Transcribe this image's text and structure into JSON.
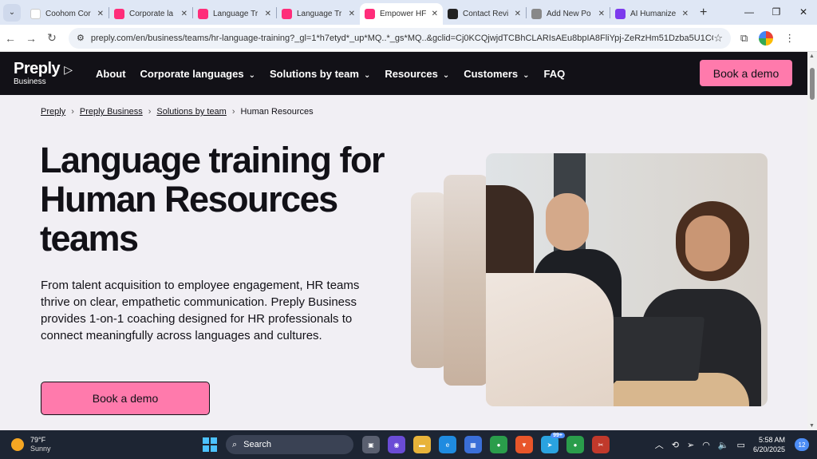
{
  "browser": {
    "tabs": [
      {
        "label": "Coohom Cor",
        "icon": "google-icon",
        "color": "#ffffff"
      },
      {
        "label": "Corporate la",
        "icon": "preply-icon",
        "color": "#ff2d7a"
      },
      {
        "label": "Language Tr",
        "icon": "preply-icon",
        "color": "#ff2d7a"
      },
      {
        "label": "Language Tr",
        "icon": "preply-icon",
        "color": "#ff2d7a"
      },
      {
        "label": "Empower HF",
        "icon": "preply-icon",
        "color": "#ff2d7a",
        "active": true
      },
      {
        "label": "Contact Revi",
        "icon": "openai-icon",
        "color": "#222222"
      },
      {
        "label": "Add New Po",
        "icon": "wordpress-icon",
        "color": "#888888"
      },
      {
        "label": "AI Humanize",
        "icon": "ai-icon",
        "color": "#7c3aed"
      }
    ],
    "new_tab": "+",
    "url": "preply.com/en/business/teams/hr-language-training?_gl=1*h7etyd*_up*MQ..*_gs*MQ..&gclid=Cj0KCQjwjdTCBhCLARIsAEu8bpIA8FliYpj-ZeRzHm51Dzba5U1CO6-F-4..."
  },
  "site": {
    "logo_main": "Preply",
    "logo_sub": "Business",
    "nav": [
      {
        "label": "About",
        "dropdown": false
      },
      {
        "label": "Corporate languages",
        "dropdown": true
      },
      {
        "label": "Solutions by team",
        "dropdown": true
      },
      {
        "label": "Resources",
        "dropdown": true
      },
      {
        "label": "Customers",
        "dropdown": true
      },
      {
        "label": "FAQ",
        "dropdown": false
      }
    ],
    "cta_top": "Book a demo"
  },
  "breadcrumb": [
    "Preply",
    "Preply Business",
    "Solutions by team",
    "Human Resources"
  ],
  "hero": {
    "title": "Language training for Human Resources teams",
    "text": "From talent acquisition to employee engagement, HR teams thrive on clear, empathetic communication. Preply Business provides 1-on-1 coaching designed for HR professionals to connect meaningfully across languages and cultures.",
    "cta": "Book a demo"
  },
  "taskbar": {
    "temp": "79°F",
    "weather": "Sunny",
    "search_label": "Search",
    "badge_count": "99+",
    "time": "5:58 AM",
    "date": "6/20/2025",
    "notifications": "12"
  },
  "colors": {
    "accent": "#ff7aac",
    "nav_bg": "#121117",
    "page_bg": "#f1eff4"
  }
}
